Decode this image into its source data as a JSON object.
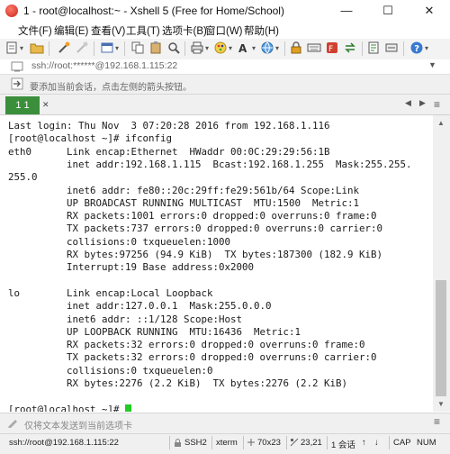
{
  "window": {
    "title": "1 - root@localhost:~ - Xshell 5 (Free for Home/School)",
    "minimize": "—",
    "maximize": "☐",
    "close": "✕"
  },
  "menu": [
    "文件(F)",
    "编辑(E)",
    "查看(V)",
    "工具(T)",
    "选项卡(B)",
    "窗口(W)",
    "帮助(H)"
  ],
  "toolbar": {
    "icons": [
      "new-session-icon",
      "open-folder-icon",
      "connect-icon",
      "disconnect-icon",
      "properties-icon",
      "copy-icon",
      "paste-icon",
      "find-icon",
      "print-icon",
      "color-scheme-icon",
      "font-icon",
      "globe-icon",
      "lock-icon",
      "keyboard-icon",
      "xftp-icon",
      "transfer-icon",
      "script-icon",
      "compose-icon",
      "help-icon"
    ]
  },
  "address": {
    "text": "ssh://root:******@192.168.1.115:22"
  },
  "hint": {
    "text": "要添加当前会话，点击左侧的箭头按钮。"
  },
  "tabs": [
    {
      "label": "1 1",
      "active": true,
      "color": "#3b8f3b"
    }
  ],
  "terminal": {
    "lines": [
      "Last login: Thu Nov  3 07:20:28 2016 from 192.168.1.116",
      "[root@localhost ~]# ifconfig",
      "eth0      Link encap:Ethernet  HWaddr 00:0C:29:29:56:1B",
      "          inet addr:192.168.1.115  Bcast:192.168.1.255  Mask:255.255.",
      "255.0",
      "          inet6 addr: fe80::20c:29ff:fe29:561b/64 Scope:Link",
      "          UP BROADCAST RUNNING MULTICAST  MTU:1500  Metric:1",
      "          RX packets:1001 errors:0 dropped:0 overruns:0 frame:0",
      "          TX packets:737 errors:0 dropped:0 overruns:0 carrier:0",
      "          collisions:0 txqueuelen:1000",
      "          RX bytes:97256 (94.9 KiB)  TX bytes:187300 (182.9 KiB)",
      "          Interrupt:19 Base address:0x2000",
      "",
      "lo        Link encap:Local Loopback",
      "          inet addr:127.0.0.1  Mask:255.0.0.0",
      "          inet6 addr: ::1/128 Scope:Host",
      "          UP LOOPBACK RUNNING  MTU:16436  Metric:1",
      "          RX packets:32 errors:0 dropped:0 overruns:0 frame:0",
      "          TX packets:32 errors:0 dropped:0 overruns:0 carrier:0",
      "          collisions:0 txqueuelen:0",
      "          RX bytes:2276 (2.2 KiB)  TX bytes:2276 (2.2 KiB)",
      "",
      "[root@localhost ~]# "
    ],
    "cursor_color": "#22cc22"
  },
  "compose": {
    "text": "仅将文本发送到当前选项卡"
  },
  "status": {
    "address": "ssh://root@192.168.1.115:22",
    "protocol": "SSH2",
    "terminal": "xterm",
    "size": "70x23",
    "position": "23,21",
    "sessions": "1 会话",
    "caps": "CAP",
    "num": "NUM"
  }
}
